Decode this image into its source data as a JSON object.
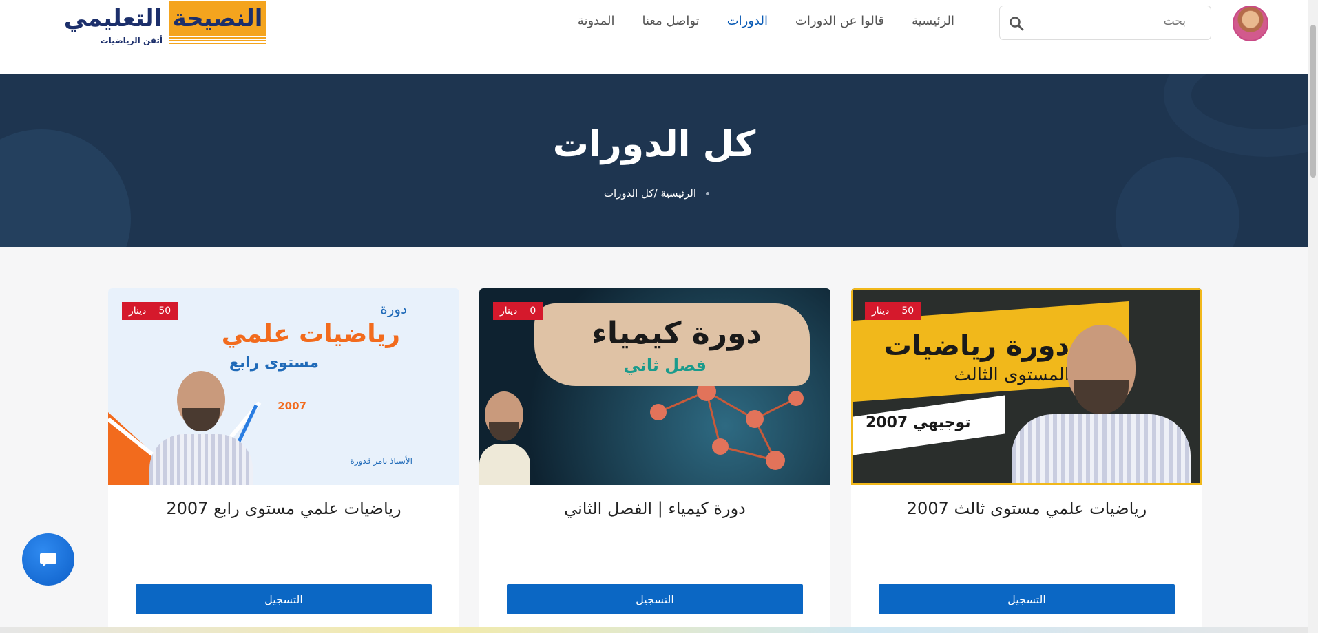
{
  "header": {
    "logo_main": "التعليمي",
    "logo_accent": "النصيحة",
    "logo_tagline": "أتقن الرياضيات",
    "nav": [
      "الرئيسية",
      "قالوا عن الدورات",
      "الدورات",
      "تواصل معنا",
      "المدونة"
    ],
    "nav_active_index": 2,
    "search_placeholder": "بحث"
  },
  "hero": {
    "title": "كل الدورات",
    "breadcrumb": "الرئيسية /كل الدورات"
  },
  "courses": [
    {
      "title": "رياضيات علمي مستوى ثالث 2007",
      "price": "50",
      "currency": "دينار",
      "enroll_label": "التسجيل",
      "thumb_line1": "دورة رياضيات",
      "thumb_line2": "المستوى الثالث",
      "thumb_line3": "توجيهي 2007"
    },
    {
      "title": "دورة كيمياء | الفصل الثاني",
      "price": "0",
      "currency": "دينار",
      "enroll_label": "التسجيل",
      "thumb_line1": "دورة كيمياء",
      "thumb_line2": "فصل ثاني"
    },
    {
      "title": "رياضيات علمي مستوى رابع 2007",
      "price": "50",
      "currency": "دينار",
      "enroll_label": "التسجيل",
      "thumb_line1": "دورة",
      "thumb_line2": "رياضيات علمي",
      "thumb_line3": "مستوى رابع",
      "thumb_line4": "2007",
      "thumb_line5": "الأستاذ تامر قدورة"
    }
  ],
  "colors": {
    "accent": "#0b67c4",
    "hero_bg": "#1e3550",
    "price_badge": "#d5192c",
    "logo_orange": "#f4a41e"
  },
  "icons": [
    "search-icon",
    "chat-icon"
  ]
}
